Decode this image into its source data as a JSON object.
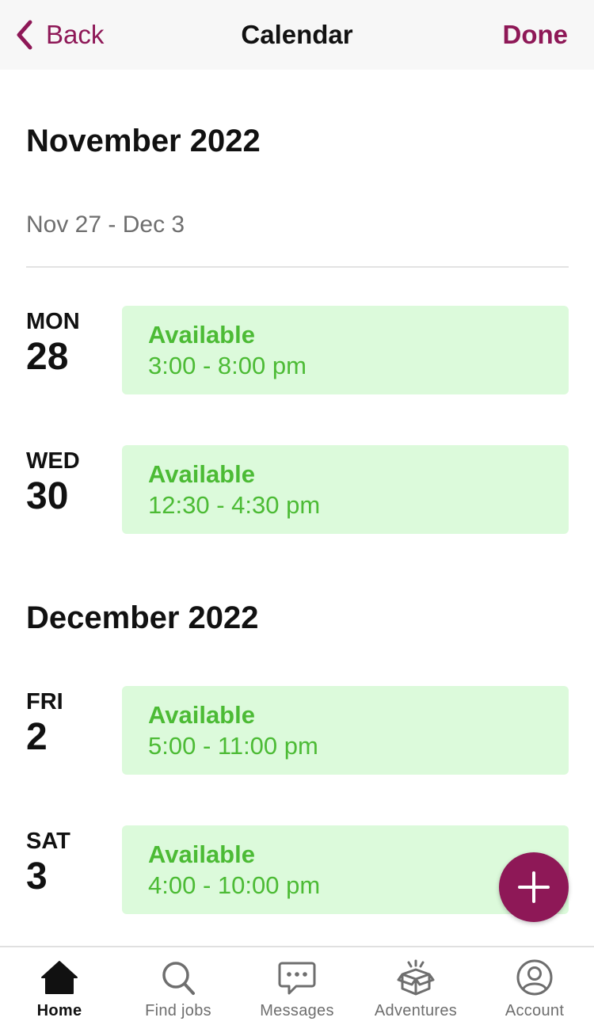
{
  "nav": {
    "back_label": "Back",
    "title": "Calendar",
    "done_label": "Done"
  },
  "accent_color": "#8e1857",
  "available_color": "#4cbb35",
  "available_bg": "#dcfadb",
  "months": [
    {
      "heading": "November 2022",
      "week_range": "Nov 27 - Dec 3",
      "days": [
        {
          "weekday": "MON",
          "number": "28",
          "status": "Available",
          "time": "3:00 - 8:00 pm"
        },
        {
          "weekday": "WED",
          "number": "30",
          "status": "Available",
          "time": "12:30 - 4:30 pm"
        }
      ]
    },
    {
      "heading": "December 2022",
      "days": [
        {
          "weekday": "FRI",
          "number": "2",
          "status": "Available",
          "time": "5:00 - 11:00 pm"
        },
        {
          "weekday": "SAT",
          "number": "3",
          "status": "Available",
          "time": "4:00 - 10:00 pm"
        }
      ]
    }
  ],
  "fab_icon": "plus-icon",
  "tabs": [
    {
      "label": "Home",
      "icon": "home-icon",
      "active": true
    },
    {
      "label": "Find jobs",
      "icon": "search-icon",
      "active": false
    },
    {
      "label": "Messages",
      "icon": "chat-icon",
      "active": false
    },
    {
      "label": "Adventures",
      "icon": "gift-box-icon",
      "active": false
    },
    {
      "label": "Account",
      "icon": "account-icon",
      "active": false
    }
  ]
}
